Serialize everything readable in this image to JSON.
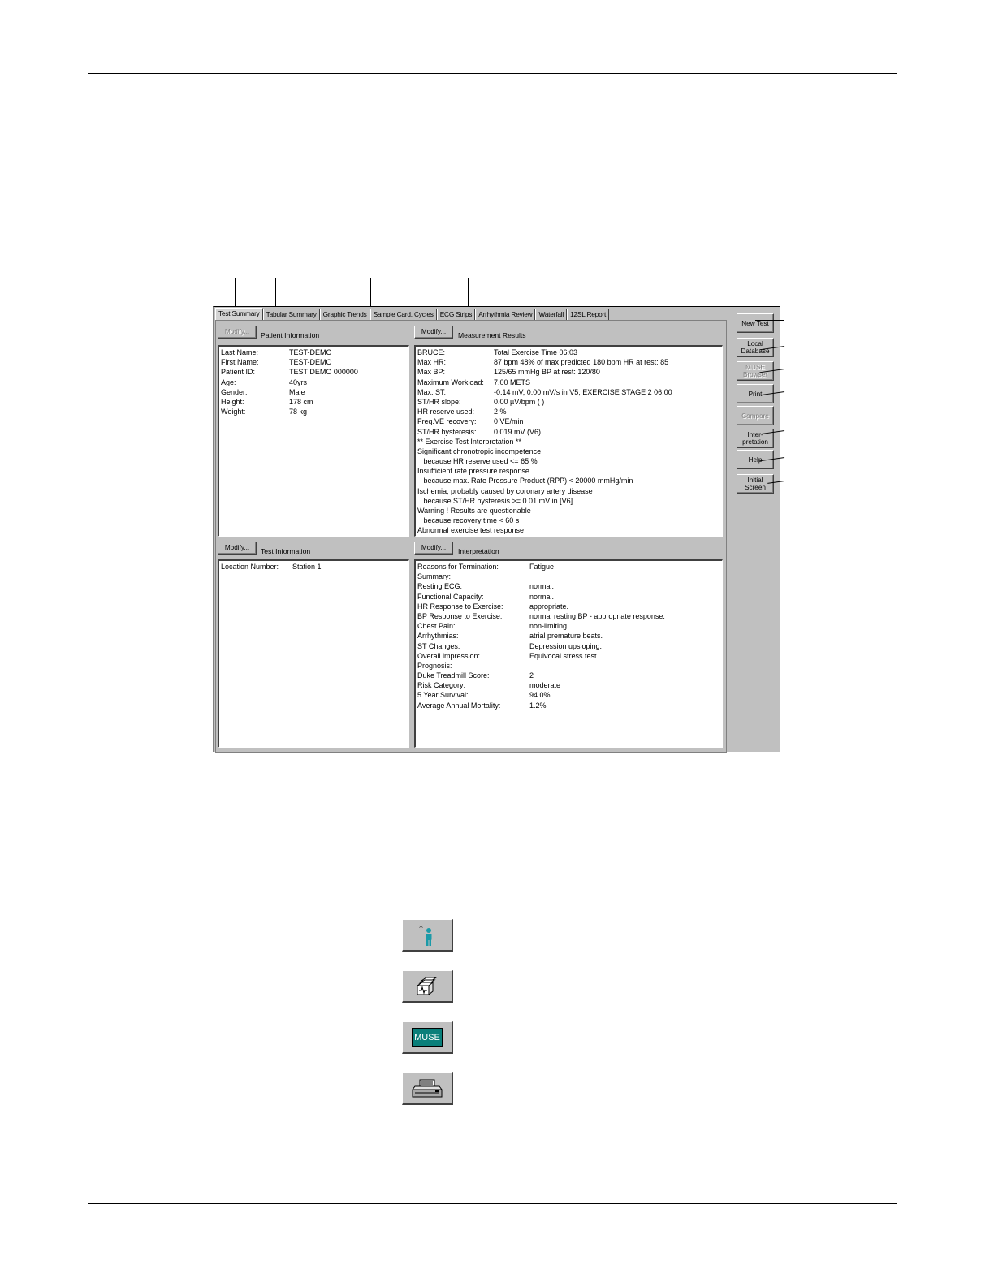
{
  "tabs": [
    "Test Summary",
    "Tabular Summary",
    "Graphic Trends",
    "Sample Card. Cycles",
    "ECG Strips",
    "Arrhythmia Review",
    "Waterfall",
    "12SL Report"
  ],
  "modify_label": "Modify...",
  "patient_info": {
    "title": "Patient Information",
    "rows": [
      {
        "k": "Last Name:",
        "v": "TEST-DEMO"
      },
      {
        "k": "First Name:",
        "v": "TEST-DEMO"
      },
      {
        "k": "Patient ID:",
        "v": "TEST DEMO 000000"
      },
      {
        "k": "Age:",
        "v": "40yrs"
      },
      {
        "k": "Gender:",
        "v": "Male"
      },
      {
        "k": "Height:",
        "v": "178 cm"
      },
      {
        "k": "Weight:",
        "v": "78 kg"
      }
    ]
  },
  "measurement_results": {
    "title": "Measurement Results",
    "rows": [
      {
        "k": "BRUCE:",
        "v": "Total Exercise Time  06:03"
      },
      {
        "k": "Max HR:",
        "v": "87 bpm   48% of max predicted 180 bpm    HR at rest: 85"
      },
      {
        "k": "Max BP:",
        "v": "125/65 mmHg    BP at rest: 120/80"
      },
      {
        "k": "Maximum Workload:",
        "v": "7.00 METS"
      },
      {
        "k": "Max. ST:",
        "v": "-0.14 mV,  0.00 mV/s  in V5; EXERCISE  STAGE 2   06:00"
      },
      {
        "k": "ST/HR slope:",
        "v": "0.00 µV/bpm ( )"
      },
      {
        "k": "HR reserve used:",
        "v": "2 %"
      },
      {
        "k": "Freq.VE recovery:",
        "v": "0 VE/min"
      },
      {
        "k": "ST/HR hysteresis:",
        "v": "0.019 mV (V6)"
      }
    ],
    "lines": [
      "** Exercise Test Interpretation **",
      "Significant chronotropic incompetence",
      "   because HR reserve used <= 65 %",
      "Insufficient rate pressure response",
      "   because max. Rate Pressure Product (RPP) < 20000 mmHg/min",
      "Ischemia, probably caused by coronary artery disease",
      "   because ST/HR hysteresis >= 0.01 mV in [V6]",
      "Warning ! Results are questionable",
      "   because recovery time < 60 s",
      "Abnormal exercise test response"
    ]
  },
  "test_info": {
    "title": "Test Information",
    "rows": [
      {
        "k": "Location Number:",
        "v": "Station 1"
      }
    ]
  },
  "interpretation": {
    "title": "Interpretation",
    "rows": [
      {
        "k": "Reasons for Termination:",
        "v": "Fatigue"
      },
      {
        "k": "Summary:",
        "v": ""
      },
      {
        "k": "Resting ECG:",
        "v": "normal."
      },
      {
        "k": "Functional Capacity:",
        "v": "normal."
      },
      {
        "k": "HR Response to Exercise:",
        "v": "appropriate."
      },
      {
        "k": "BP Response to Exercise:",
        "v": "normal resting BP - appropriate response."
      },
      {
        "k": "Chest Pain:",
        "v": "non-limiting."
      },
      {
        "k": "Arrhythmias:",
        "v": "atrial premature beats."
      },
      {
        "k": "ST Changes:",
        "v": "Depression upsloping."
      },
      {
        "k": "Overall impression:",
        "v": "Equivocal stress test."
      },
      {
        "k": "Prognosis:",
        "v": ""
      },
      {
        "k": "Duke Treadmill Score:",
        "v": "2"
      },
      {
        "k": "Risk Category:",
        "v": "moderate"
      },
      {
        "k": "5 Year Survival:",
        "v": "94.0%"
      },
      {
        "k": "Average Annual Mortality:",
        "v": "1.2%"
      }
    ]
  },
  "side_buttons": {
    "new_test": "New Test",
    "local_db_1": "Local",
    "local_db_2": "Database",
    "muse_1": "MUSE",
    "muse_2": "Browser",
    "print": "Print",
    "compare": "Compare",
    "interp_1": "Inter-",
    "interp_2": "pretation",
    "help": "Help",
    "initial_screen": "Initial Screen"
  },
  "icons": {
    "new_patient": "new-patient-icon",
    "local_db": "local-database-icon",
    "muse": "MUSE",
    "print": "printer-icon"
  },
  "colors": {
    "muse_bg": "#0a7f7a",
    "person": "#1a9aa8"
  }
}
